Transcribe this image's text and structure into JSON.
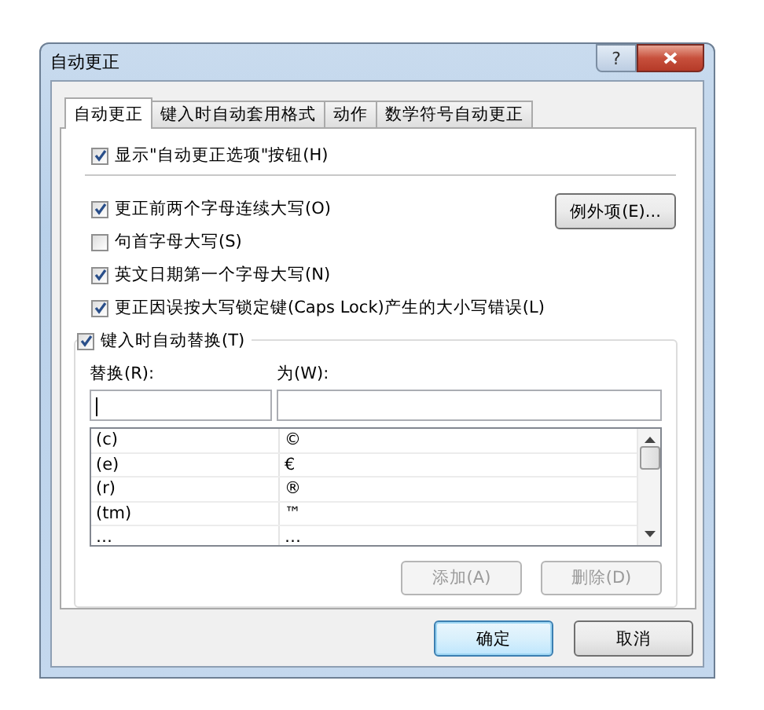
{
  "window": {
    "title": "自动更正",
    "help_button": "?"
  },
  "tabs": [
    {
      "label": "自动更正",
      "selected": true
    },
    {
      "label": "键入时自动套用格式",
      "selected": false
    },
    {
      "label": "动作",
      "selected": false
    },
    {
      "label": "数学符号自动更正",
      "selected": false
    }
  ],
  "show_options_button": {
    "label": "显示\"自动更正选项\"按钮(H)",
    "checked": true
  },
  "options": [
    {
      "label": "更正前两个字母连续大写(O)",
      "checked": true
    },
    {
      "label": "句首字母大写(S)",
      "checked": false
    },
    {
      "label": "英文日期第一个字母大写(N)",
      "checked": true
    },
    {
      "label": "更正因误按大写锁定键(Caps Lock)产生的大小写错误(L)",
      "checked": true
    }
  ],
  "exceptions_button": "例外项(E)...",
  "replace_group": {
    "label": "键入时自动替换(T)",
    "checked": true,
    "replace_label": "替换(R):",
    "with_label": "为(W):",
    "rows": [
      {
        "replace": "(c)",
        "with": "©"
      },
      {
        "replace": "(e)",
        "with": "€"
      },
      {
        "replace": "(r)",
        "with": "®"
      },
      {
        "replace": "(tm)",
        "with": "™"
      },
      {
        "replace": "…",
        "with": "…"
      }
    ],
    "buttons": [
      {
        "label": "添加(A)",
        "disabled": true
      },
      {
        "label": "删除(D)",
        "disabled": true
      }
    ]
  },
  "buttons": [
    {
      "label": "确定",
      "default": true
    },
    {
      "label": "取消",
      "default": false
    }
  ]
}
